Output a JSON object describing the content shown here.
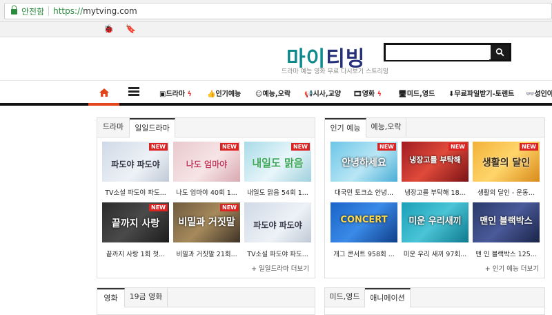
{
  "browser": {
    "secure_label": "안전함",
    "url_scheme": "https://",
    "url_domain": "mytving.com"
  },
  "header": {
    "logo_part1": "마이",
    "logo_part2": "티빙",
    "tagline": "드라마 예능 영화 무료 다시보기 스트리밍",
    "search_placeholder": ""
  },
  "nav": {
    "items": [
      {
        "label": "드라마",
        "icon": "tv-icon",
        "bolt": true
      },
      {
        "label": "인기예능",
        "icon": "thumbs-up-icon",
        "bolt": false
      },
      {
        "label": "예능,오락",
        "icon": "smile-icon",
        "bolt": false
      },
      {
        "label": "시사,교양",
        "icon": "megaphone-icon",
        "bolt": false
      },
      {
        "label": "영화",
        "icon": "film-icon",
        "bolt": true
      },
      {
        "label": "미드,영드",
        "icon": "monitor-icon",
        "bolt": false
      },
      {
        "label": "무료파일받기-토렌트",
        "icon": "download-icon",
        "bolt": false
      },
      {
        "label": "성인야동",
        "icon": "glasses-icon",
        "bolt": false
      }
    ],
    "bolt_char": "ϟ"
  },
  "panel_left": {
    "tabs": [
      "드라마",
      "일일드라마"
    ],
    "items": [
      {
        "title": "TV소설 파도야 파도...",
        "thumb_text": "파도야 파도야",
        "new": "NEW"
      },
      {
        "title": "나도 엄마야 40회 1...",
        "thumb_text": "나도 엄마야",
        "new": "NEW"
      },
      {
        "title": "내일도 맑음 54회 1...",
        "thumb_text": "내일도 맑음",
        "new": "NEW"
      },
      {
        "title": "끝까지 사랑 1회 첫...",
        "thumb_text": "끝까지 사랑",
        "new": "NEW"
      },
      {
        "title": "비밀과 거짓말 21회...",
        "thumb_text": "비밀과 거짓말",
        "new": "NEW"
      },
      {
        "title": "TV소설 파도야 파도...",
        "thumb_text": "파도야 파도야",
        "new": ""
      }
    ],
    "more": "+ 일일드라마 더보기"
  },
  "panel_right": {
    "tabs": [
      "인기 예능",
      "예능,오락"
    ],
    "items": [
      {
        "title": "대국민 토크쇼 안녕...",
        "thumb_text": "안녕하세요",
        "new": "NEW"
      },
      {
        "title": "냉장고를 부탁해 18...",
        "thumb_text": "냉장고를 부탁해",
        "new": "NEW"
      },
      {
        "title": "생활의 달인 - 운동...",
        "thumb_text": "생활의 달인",
        "new": "NEW"
      },
      {
        "title": "개그 콘서트 958회 ...",
        "thumb_text": "CONCERT",
        "new": ""
      },
      {
        "title": "미운 우리 새끼 97회...",
        "thumb_text": "미운 우리새끼",
        "new": ""
      },
      {
        "title": "맨 인 블랙박스 125...",
        "thumb_text": "맨인 블랙박스",
        "new": ""
      }
    ],
    "more": "+ 인기 예능 더보기"
  },
  "panel_bottom_left": {
    "tabs": [
      "영화",
      "19금 영화"
    ]
  },
  "panel_bottom_right": {
    "tabs": [
      "미드,영드",
      "애니메이션"
    ]
  },
  "colors": {
    "accent": "#e2441c",
    "logo_teal": "#0c8a8e",
    "logo_navy": "#25307a",
    "badge": "#dd2222"
  }
}
